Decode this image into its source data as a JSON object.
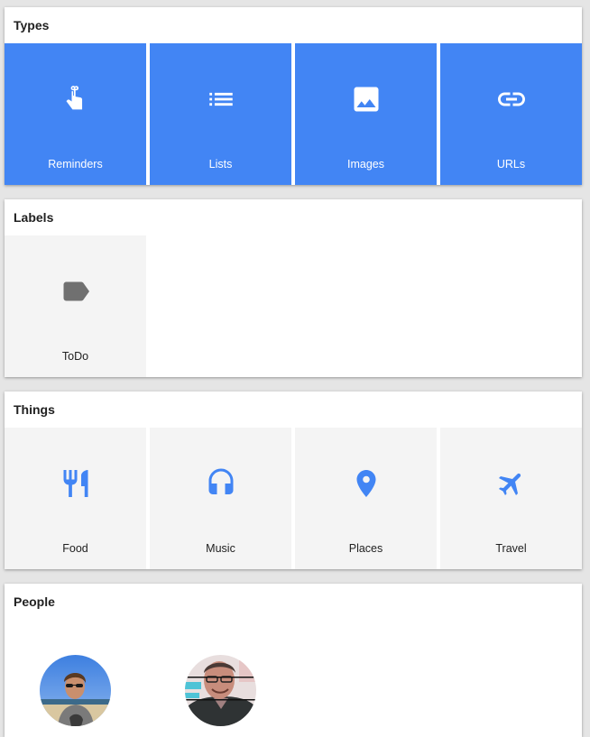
{
  "colors": {
    "accent": "#4285f4",
    "tile_grey": "#f4f4f4",
    "label_icon_grey": "#707070",
    "page_bg": "#e5e5e5"
  },
  "sections": {
    "types": {
      "title": "Types",
      "items": [
        {
          "label": "Reminders",
          "icon": "reminder-finger-icon"
        },
        {
          "label": "Lists",
          "icon": "list-icon"
        },
        {
          "label": "Images",
          "icon": "image-icon"
        },
        {
          "label": "URLs",
          "icon": "link-icon"
        }
      ]
    },
    "labels": {
      "title": "Labels",
      "items": [
        {
          "label": "ToDo",
          "icon": "label-tag-icon"
        }
      ]
    },
    "things": {
      "title": "Things",
      "items": [
        {
          "label": "Food",
          "icon": "restaurant-icon"
        },
        {
          "label": "Music",
          "icon": "headphones-icon"
        },
        {
          "label": "Places",
          "icon": "place-pin-icon"
        },
        {
          "label": "Travel",
          "icon": "airplane-icon"
        }
      ]
    },
    "people": {
      "title": "People",
      "items": [
        {
          "avatar": "person-avatar-1"
        },
        {
          "avatar": "person-avatar-2"
        }
      ]
    }
  }
}
